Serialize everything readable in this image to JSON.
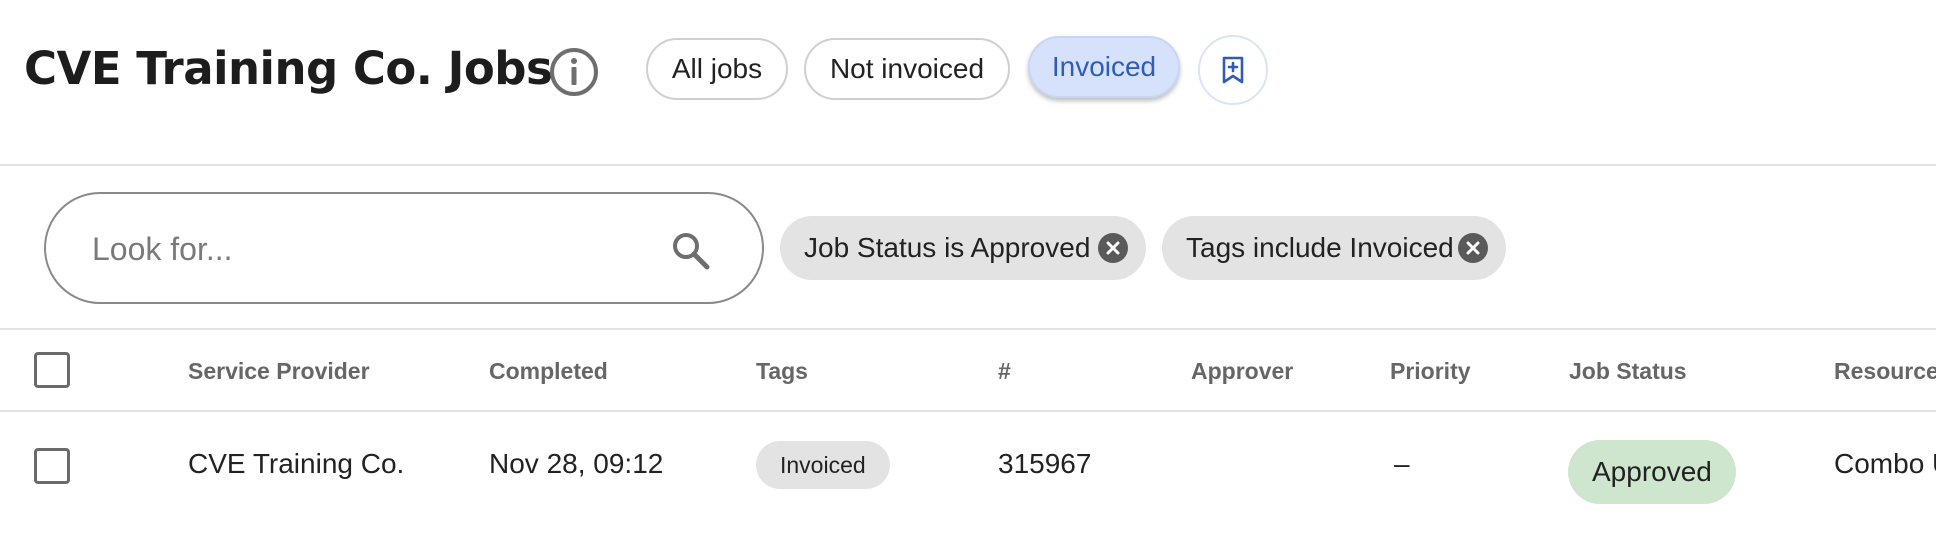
{
  "header": {
    "title": "CVE Training Co. Jobs",
    "view_tabs": [
      {
        "label": "All jobs",
        "active": false
      },
      {
        "label": "Not invoiced",
        "active": false
      },
      {
        "label": "Invoiced",
        "active": true
      }
    ]
  },
  "filters": {
    "search_placeholder": "Look for...",
    "chips": [
      {
        "label": "Job Status is Approved"
      },
      {
        "label": "Tags include Invoiced"
      }
    ]
  },
  "table": {
    "columns": [
      "Service Provider",
      "Completed",
      "Tags",
      "#",
      "Approver",
      "Priority",
      "Job Status",
      "Resource"
    ],
    "rows": [
      {
        "service_provider": "CVE Training Co.",
        "completed": "Nov 28, 09:12",
        "tag": "Invoiced",
        "number": "315967",
        "approver": "",
        "priority": "–",
        "job_status": "Approved",
        "resource": "Combo U"
      }
    ]
  },
  "colors": {
    "active_tab_bg": "#d6e2fb",
    "active_tab_text": "#2e5cb8",
    "status_approved_bg": "#cde6cd",
    "chip_bg": "#e3e3e3"
  }
}
